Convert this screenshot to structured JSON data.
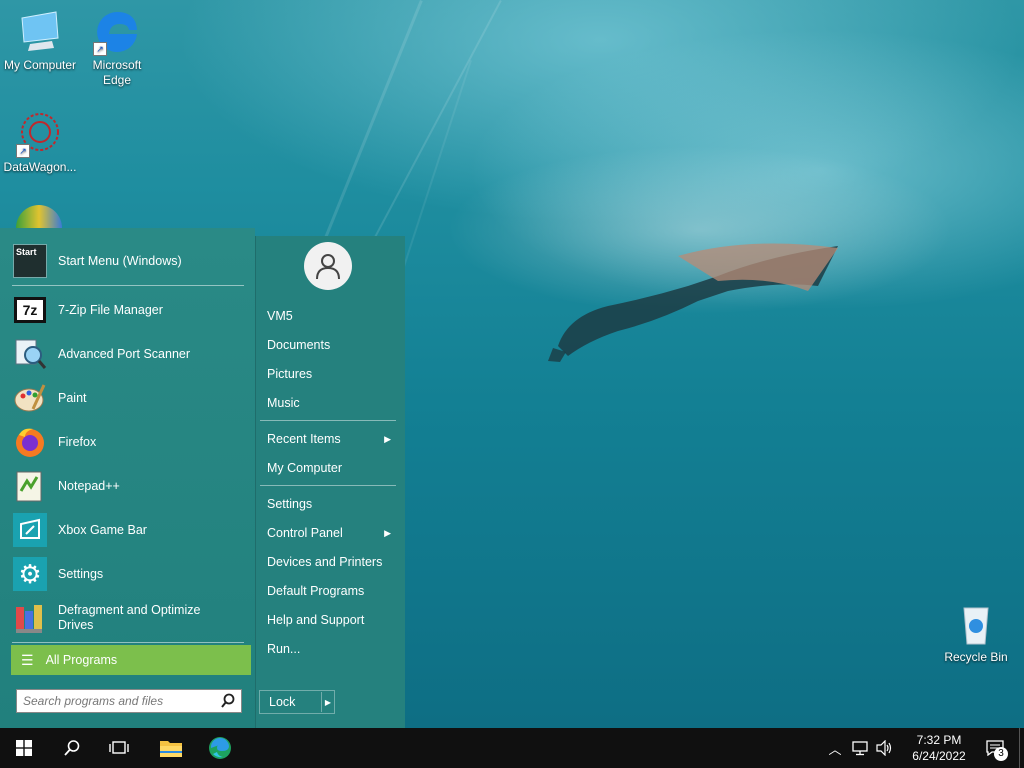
{
  "desktop": {
    "icons": [
      {
        "label": "My Computer",
        "icon": "computer-icon"
      },
      {
        "label": "Microsoft Edge",
        "icon": "edge-icon"
      },
      {
        "label": "DataWagon...",
        "icon": "datawagon-icon"
      },
      {
        "label": "Recycle Bin",
        "icon": "recycle-bin-icon"
      }
    ]
  },
  "start_menu": {
    "pinned": [
      {
        "label": "Start Menu (Windows)",
        "icon": "start-menu-icon"
      },
      {
        "label": "7-Zip File Manager",
        "icon": "7zip-icon"
      },
      {
        "label": "Advanced Port Scanner",
        "icon": "port-scanner-icon"
      },
      {
        "label": "Paint",
        "icon": "paint-icon"
      },
      {
        "label": "Firefox",
        "icon": "firefox-icon"
      },
      {
        "label": "Notepad++",
        "icon": "notepadpp-icon"
      },
      {
        "label": "Xbox Game Bar",
        "icon": "xbox-game-bar-icon"
      },
      {
        "label": "Settings",
        "icon": "settings-icon"
      },
      {
        "label": "Defragment and Optimize Drives",
        "icon": "defrag-icon"
      }
    ],
    "start_icon_text": "Start",
    "all_programs": "All Programs",
    "search_placeholder": "Search programs and files",
    "right_links": [
      {
        "label": "VM5"
      },
      {
        "label": "Documents"
      },
      {
        "label": "Pictures"
      },
      {
        "label": "Music"
      },
      {
        "label": "Recent Items",
        "submenu": true
      },
      {
        "label": "My Computer"
      },
      {
        "label": "Settings"
      },
      {
        "label": "Control Panel",
        "submenu": true
      },
      {
        "label": "Devices and Printers"
      },
      {
        "label": "Default Programs"
      },
      {
        "label": "Help and Support"
      },
      {
        "label": "Run..."
      }
    ],
    "lock_label": "Lock"
  },
  "taskbar": {
    "items": [
      "windows-start-icon",
      "search-icon",
      "task-view-icon",
      "file-explorer-icon",
      "edge-icon"
    ],
    "time": "7:32 PM",
    "date": "6/24/2022",
    "notification_count": "3"
  },
  "colors": {
    "menu_bg": "#25817e",
    "all_programs_bg": "#7cbf4c",
    "taskbar": "#101010"
  }
}
